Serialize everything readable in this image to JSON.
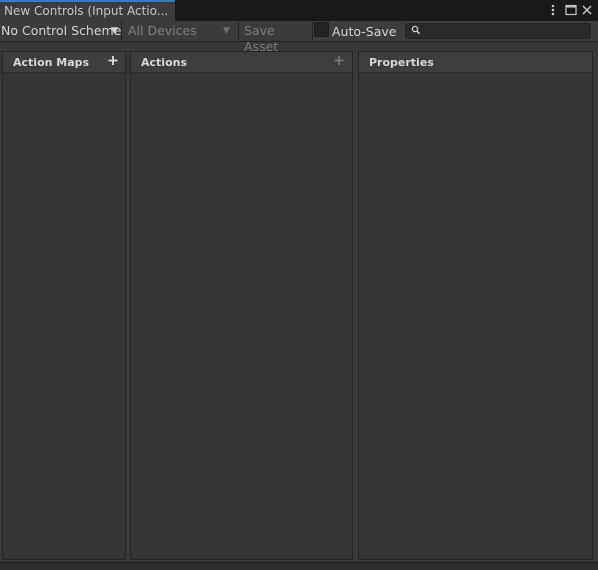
{
  "window": {
    "tab_title": "New Controls (Input Actio...",
    "controls": {
      "more_icon": "more-vertical-icon",
      "maximize_icon": "maximize-icon",
      "close_icon": "close-icon"
    }
  },
  "toolbar": {
    "control_scheme": "No Control Scheme",
    "devices": "All Devices",
    "save_asset": "Save Asset",
    "auto_save_label": "Auto-Save",
    "auto_save_checked": false,
    "search": {
      "value": "",
      "placeholder": ""
    }
  },
  "panes": {
    "action_maps": {
      "title": "Action Maps",
      "items": []
    },
    "actions": {
      "title": "Actions",
      "items": []
    },
    "properties": {
      "title": "Properties"
    }
  },
  "colors": {
    "accent": "#3a79bb",
    "background": "#383838",
    "pane": "#353535"
  }
}
